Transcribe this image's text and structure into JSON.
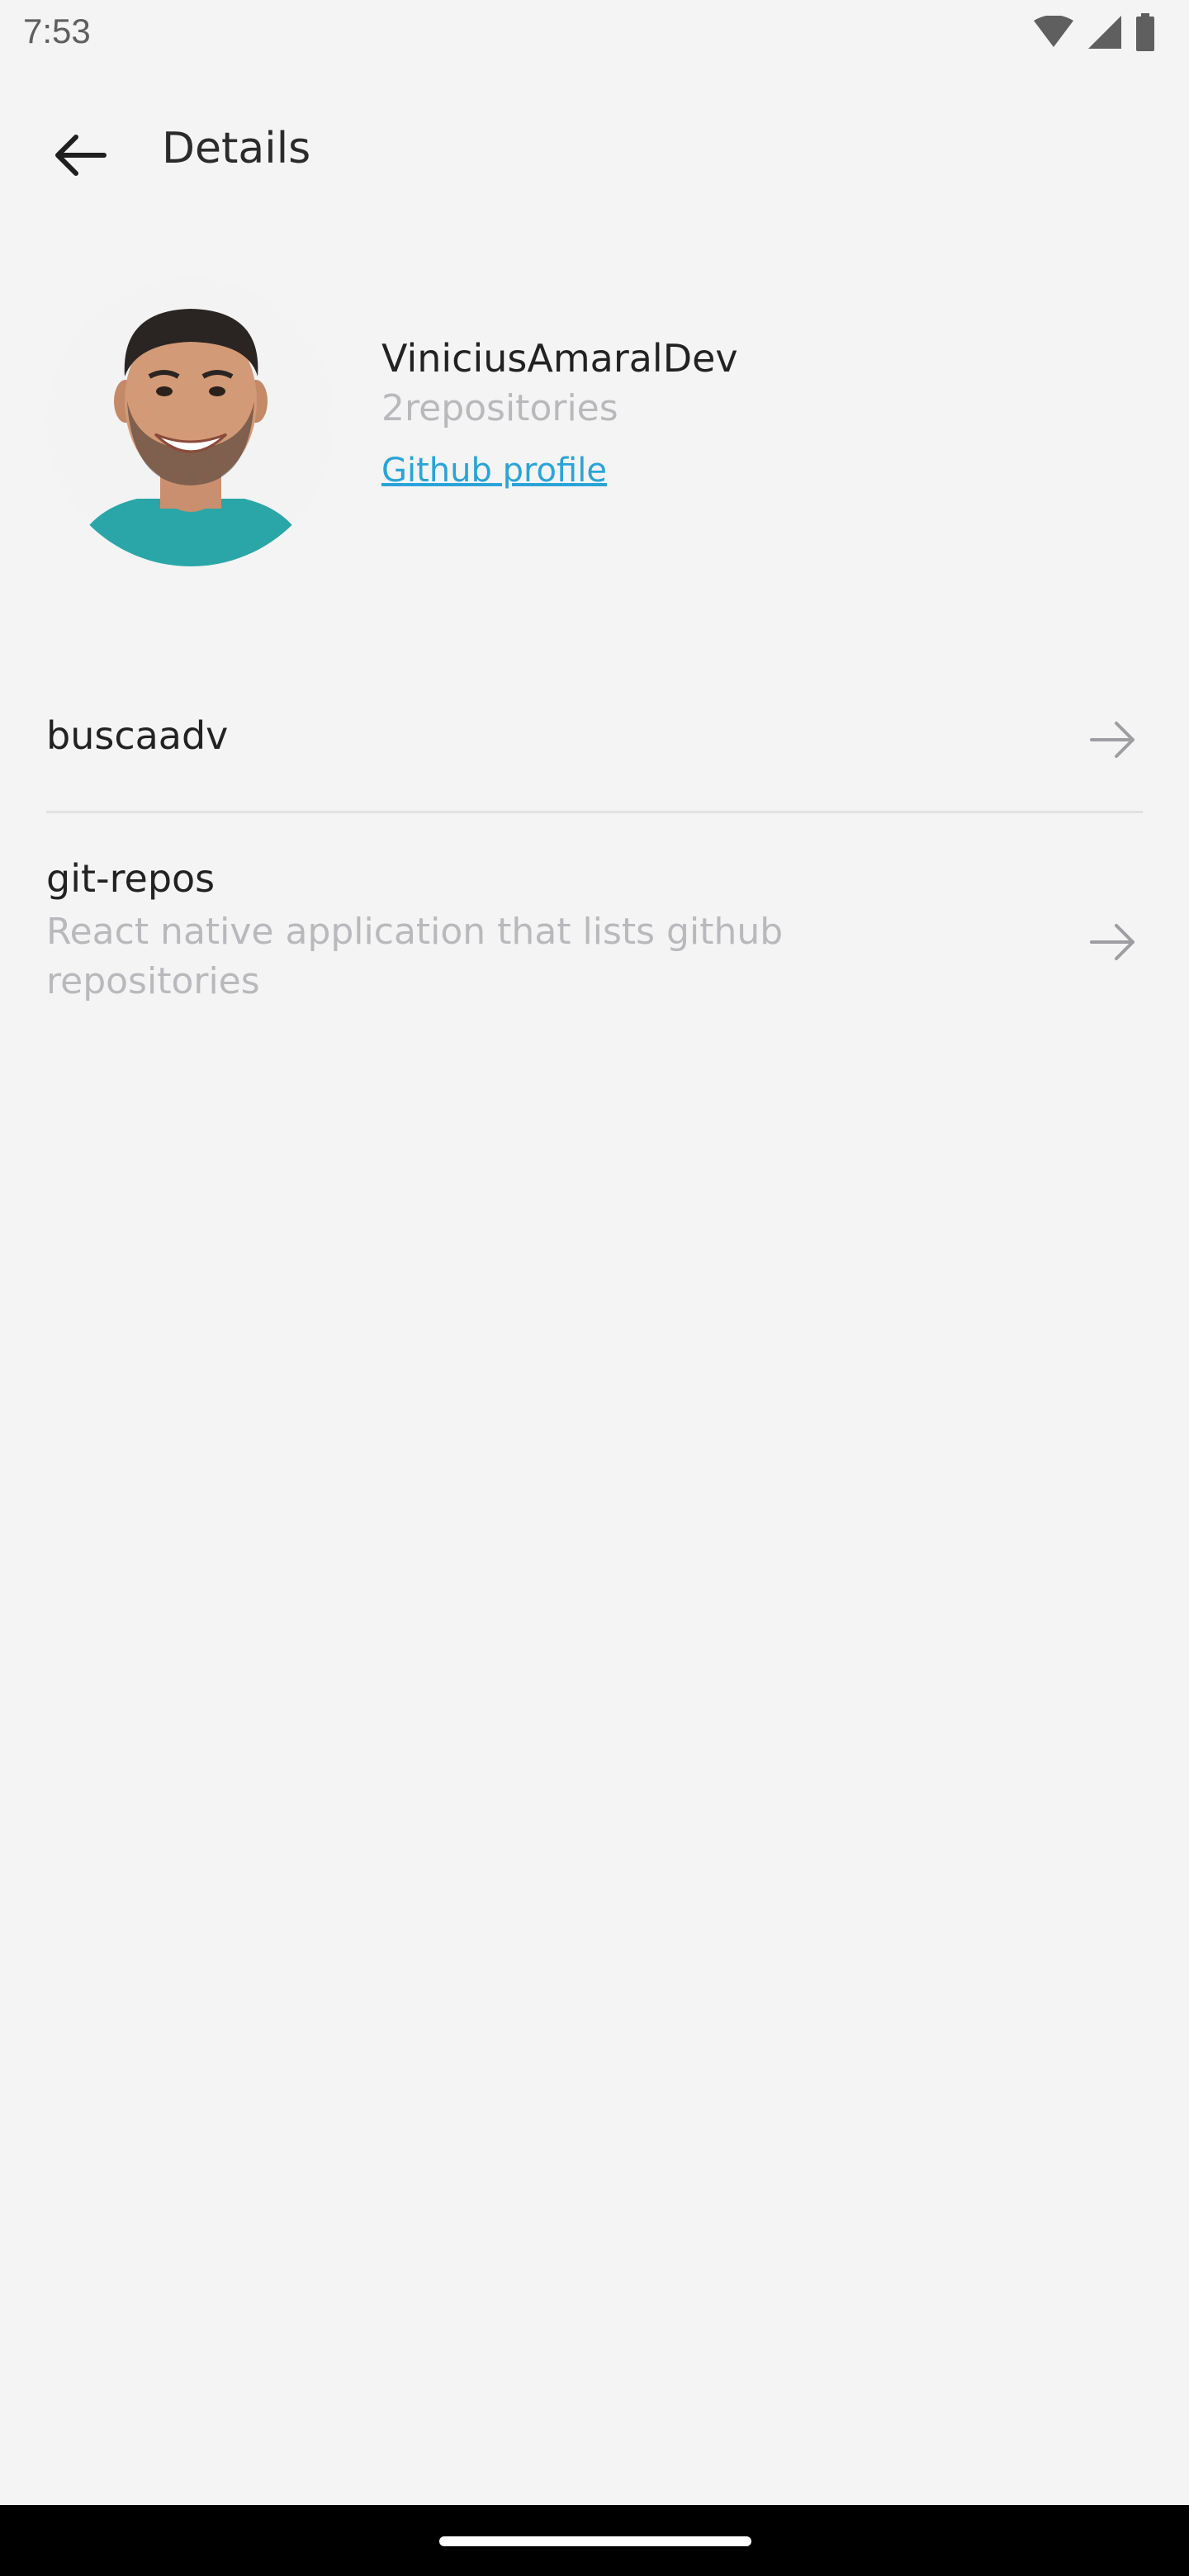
{
  "status_bar": {
    "time": "7:53",
    "icons": [
      "wifi-icon",
      "cellular-signal-icon",
      "battery-icon"
    ]
  },
  "header": {
    "back_icon": "arrow-left-icon",
    "title": "Details"
  },
  "profile": {
    "avatar_icon": "user-avatar-photo",
    "name": "ViniciusAmaralDev",
    "repositories": "2repositories",
    "link_label": "Github profile"
  },
  "repositories": [
    {
      "name": "buscaadv",
      "description": "",
      "arrow_icon": "arrow-right-icon"
    },
    {
      "name": "git-repos",
      "description": "React native application that lists github repositories",
      "arrow_icon": "arrow-right-icon"
    }
  ],
  "colors": {
    "background": "#f4f4f4",
    "link": "#2aa4d8",
    "muted_text": "#b9b9bd",
    "primary_text": "#222222",
    "divider": "#e1e1e3"
  }
}
